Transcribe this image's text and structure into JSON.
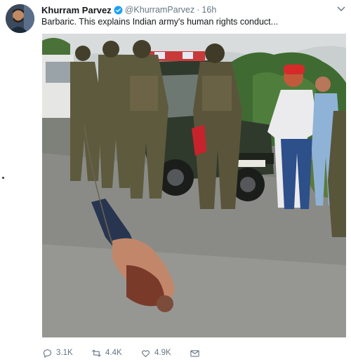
{
  "author": {
    "name": "Khurram Parvez",
    "handle": "@KhurramParvez",
    "separator": "·",
    "time": "16h",
    "verified": true
  },
  "tweet": {
    "text": "Barbaric. This explains Indian army's human rights conduct..."
  },
  "image": {
    "description_icon": "photo"
  },
  "actions": {
    "replies": "3.1K",
    "retweets": "4.4K",
    "likes": "4.9K"
  },
  "colors": {
    "secondary_text": "#657786",
    "primary_text": "#14171a",
    "verified_blue": "#1da1f2"
  }
}
